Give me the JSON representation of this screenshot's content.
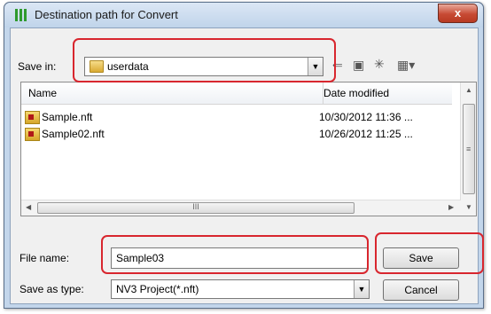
{
  "window": {
    "title": "Destination path for Convert",
    "close_glyph": "x"
  },
  "save_in": {
    "label": "Save in:",
    "value": "userdata"
  },
  "toolbar": {
    "back_icon": "back-arrow-icon",
    "up_icon": "up-folder-icon",
    "new_folder_icon": "new-folder-icon",
    "views_icon": "views-menu-icon"
  },
  "list": {
    "columns": [
      "Name",
      "Date modified"
    ],
    "files": [
      {
        "name": "Sample.nft",
        "date": "10/30/2012 11:36 ..."
      },
      {
        "name": "Sample02.nft",
        "date": "10/26/2012 11:25 ..."
      }
    ],
    "hscroll_grip": "III",
    "vscroll_grip": "≡"
  },
  "file_name": {
    "label": "File name:",
    "value": "Sample03"
  },
  "save_as_type": {
    "label": "Save as type:",
    "value": "NV3 Project(*.nft)"
  },
  "buttons": {
    "save": "Save",
    "cancel": "Cancel"
  },
  "colors": {
    "highlight": "#d8262e"
  }
}
